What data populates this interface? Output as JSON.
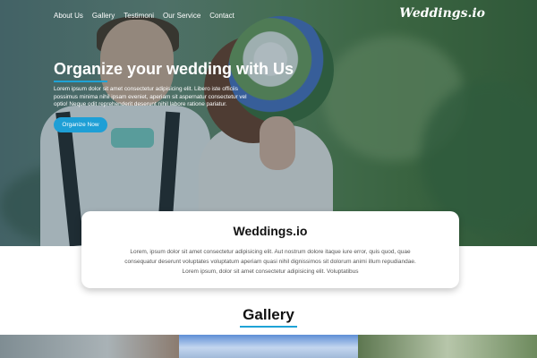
{
  "nav": {
    "items": [
      "About Us",
      "Gallery",
      "Testimoni",
      "Our Service",
      "Contact"
    ],
    "brand": "Weddings.io"
  },
  "hero": {
    "title": "Organize your wedding with Us",
    "text": "Lorem ipsum dolor sit amet consectetur adipisicing elit. Libero iste officiis possimus minima nihil ipsam eveniet, aperiam sit aspernatur consectetur vel optio! Neque odit reprehenderit deserunt nihil labore ratione pariatur.",
    "cta_label": "Organize Now"
  },
  "card": {
    "title": "Weddings.io",
    "text": "Lorem, ipsum dolor sit amet consectetur adipisicing elit. Aut nostrum dolore itaque iure error, quis quod, quae consequatur deserunt voluptates voluptatum aperiam quasi nihil dignissimos sit dolorum animi illum repudiandae. Lorem ipsum, dolor sit amet consectetur adipisicing elit. Voluptatibus"
  },
  "gallery": {
    "title": "Gallery"
  },
  "colors": {
    "accent": "#1e9fd6"
  }
}
